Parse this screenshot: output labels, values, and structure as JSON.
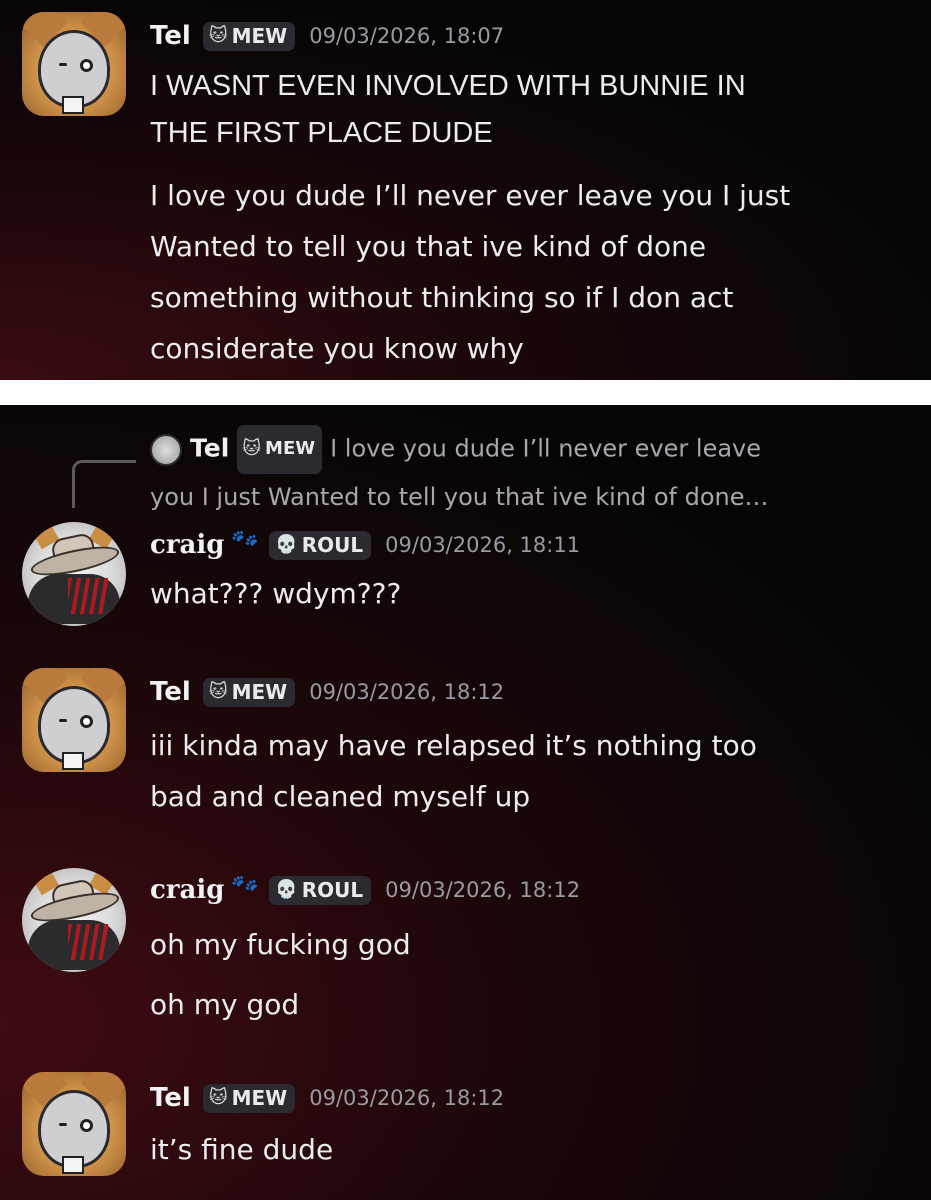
{
  "panel_top": {
    "message": {
      "author": "Tel",
      "tag_icon": "cat-icon",
      "tag": "MEW",
      "timestamp": "09/03/2026, 18:07",
      "line1": "I WASNT EVEN INVOLVED WITH BUNNIE IN",
      "line2": "THE FIRST PLACE DUDE",
      "line3": "I love you dude I’ll never ever leave you I just",
      "line4": "Wanted to tell you that  ive kind of done",
      "line5": "something without thinking so if I don act",
      "line6": "considerate you know why"
    }
  },
  "panel_bottom": {
    "reply": {
      "author": "Tel",
      "tag": "MEW",
      "preview1": "I love you dude I’ll never ever leave",
      "preview2": "you I just   Wanted to tell you that  ive kind of done…"
    },
    "messages": [
      {
        "author": "craig",
        "tag_icon": "skull-icon",
        "tag": "ROUL",
        "timestamp": "09/03/2026, 18:11",
        "lines": [
          "what??? wdym???"
        ]
      },
      {
        "author": "Tel",
        "tag_icon": "cat-icon",
        "tag": "MEW",
        "timestamp": "09/03/2026, 18:12",
        "lines": [
          "iii kinda may have relapsed it’s nothing too",
          "bad and cleaned myself up"
        ]
      },
      {
        "author": "craig",
        "tag_icon": "skull-icon",
        "tag": "ROUL",
        "timestamp": "09/03/2026, 18:12",
        "lines": [
          "oh my fucking god",
          "oh my god"
        ]
      },
      {
        "author": "Tel",
        "tag_icon": "cat-icon",
        "tag": "MEW",
        "timestamp": "09/03/2026, 18:12",
        "lines": [
          "it’s fine dude"
        ]
      }
    ]
  },
  "colors": {
    "background": "#050506",
    "accent_red": "#3a0c11",
    "tag_bg": "#2a2a30",
    "timestamp": "#9a9aa3"
  }
}
